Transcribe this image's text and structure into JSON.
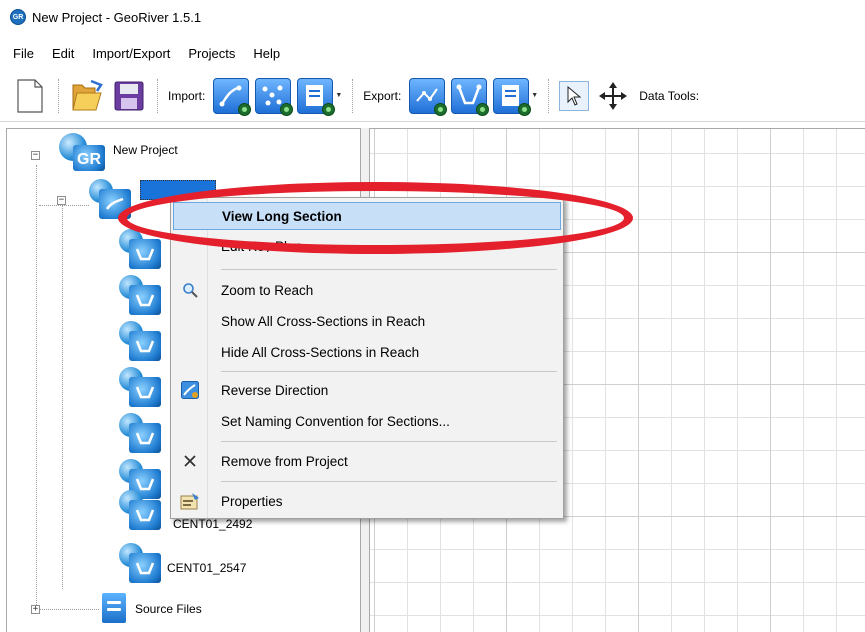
{
  "window": {
    "icon_text": "GR",
    "title": "New Project - GeoRiver 1.5.1"
  },
  "menu": {
    "items": [
      "File",
      "Edit",
      "Import/Export",
      "Projects",
      "Help"
    ]
  },
  "toolbar": {
    "import_label": "Import:",
    "export_label": "Export:",
    "data_tools_label": "Data Tools:"
  },
  "tree": {
    "root_label": "New Project",
    "root_icon_text": "GR",
    "sections": [
      "CENT01_2492",
      "CENT01_2547"
    ],
    "source_files_label": "Source Files"
  },
  "context_menu": {
    "items": [
      {
        "label": "View Long Section",
        "icon": "none",
        "highlighted": true
      },
      {
        "label": "Edit Key Plan",
        "icon": "none"
      },
      {
        "label": "Zoom to Reach",
        "icon": "magnifier-icon"
      },
      {
        "label": "Show All Cross-Sections in Reach",
        "icon": "none"
      },
      {
        "label": "Hide All Cross-Sections in Reach",
        "icon": "none"
      },
      {
        "label": "Reverse Direction",
        "icon": "reverse-direction-icon"
      },
      {
        "label": "Set Naming Convention for Sections...",
        "icon": "none"
      },
      {
        "label": "Remove from Project",
        "icon": "close-x-icon"
      },
      {
        "label": "Properties",
        "icon": "properties-icon"
      }
    ]
  },
  "colors": {
    "annotation_red": "#e3202b",
    "highlight_bg": "#c7e0f7",
    "selection_blue": "#1a73d9"
  }
}
